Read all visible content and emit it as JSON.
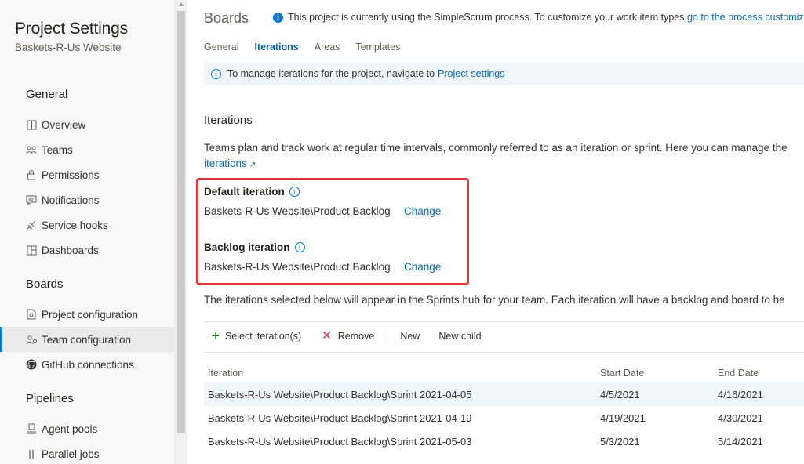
{
  "sidebar": {
    "title": "Project Settings",
    "subtitle": "Baskets-R-Us Website",
    "sections": [
      {
        "heading": "General",
        "items": [
          {
            "label": "Overview",
            "icon": "overview-icon"
          },
          {
            "label": "Teams",
            "icon": "teams-icon"
          },
          {
            "label": "Permissions",
            "icon": "lock-icon"
          },
          {
            "label": "Notifications",
            "icon": "notification-icon"
          },
          {
            "label": "Service hooks",
            "icon": "service-hooks-icon"
          },
          {
            "label": "Dashboards",
            "icon": "dashboards-icon"
          }
        ]
      },
      {
        "heading": "Boards",
        "items": [
          {
            "label": "Project configuration",
            "icon": "project-config-icon"
          },
          {
            "label": "Team configuration",
            "icon": "team-config-icon",
            "selected": true
          },
          {
            "label": "GitHub connections",
            "icon": "github-icon"
          }
        ]
      },
      {
        "heading": "Pipelines",
        "items": [
          {
            "label": "Agent pools",
            "icon": "agent-pools-icon"
          },
          {
            "label": "Parallel jobs",
            "icon": "parallel-jobs-icon"
          }
        ]
      }
    ]
  },
  "header": {
    "title": "Boards",
    "process_info": "This project is currently using the SimpleScrum process. To customize your work item types, ",
    "process_link": "go to the process customization"
  },
  "tabs": [
    "General",
    "Iterations",
    "Areas",
    "Templates"
  ],
  "active_tab": "Iterations",
  "banner": {
    "text": "To manage iterations for the project, navigate to ",
    "link": "Project settings"
  },
  "iterations": {
    "title": "Iterations",
    "description": "Teams plan and track work at regular time intervals, commonly referred to as an iteration or sprint. Here you can manage the",
    "link": "iterations",
    "default_label": "Default iteration",
    "default_value": "Baskets-R-Us Website\\Product Backlog",
    "backlog_label": "Backlog iteration",
    "backlog_value": "Baskets-R-Us Website\\Product Backlog",
    "change_label": "Change",
    "selection_note": "The iterations selected below will appear in the Sprints hub for your team. Each iteration will have a backlog and board to he"
  },
  "toolbar": {
    "select": "Select iteration(s)",
    "remove": "Remove",
    "new": "New",
    "new_child": "New child"
  },
  "table": {
    "headers": [
      "Iteration",
      "Start Date",
      "End Date"
    ],
    "rows": [
      {
        "iteration": "Baskets-R-Us Website\\Product Backlog\\Sprint 2021-04-05",
        "start": "4/5/2021",
        "end": "4/16/2021",
        "selected": true
      },
      {
        "iteration": "Baskets-R-Us Website\\Product Backlog\\Sprint 2021-04-19",
        "start": "4/19/2021",
        "end": "4/30/2021"
      },
      {
        "iteration": "Baskets-R-Us Website\\Product Backlog\\Sprint 2021-05-03",
        "start": "5/3/2021",
        "end": "5/14/2021"
      }
    ]
  },
  "colors": {
    "accent": "#0078d4",
    "highlight_box": "#e0393e",
    "add": "#107c10",
    "remove": "#d13438"
  }
}
